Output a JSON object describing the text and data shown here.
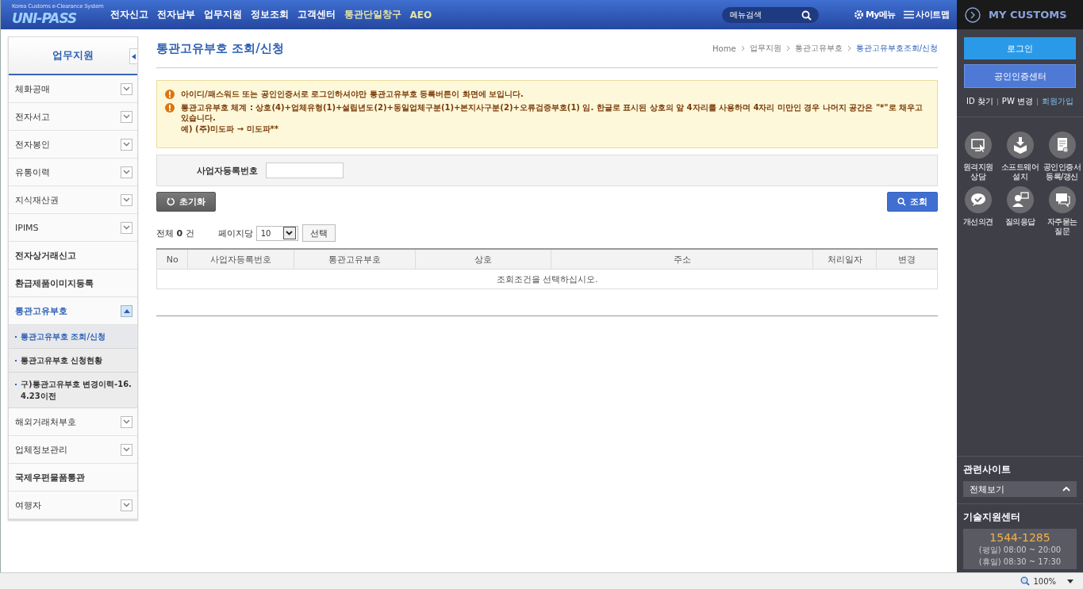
{
  "header": {
    "logo": "UNI-PASS",
    "logo_subtitle": "Korea Customs e-Clearance System",
    "nav": [
      {
        "label": "전자신고",
        "color": "#ffffff"
      },
      {
        "label": "전자납부",
        "color": "#ffffff"
      },
      {
        "label": "업무지원",
        "color": "#ffffff"
      },
      {
        "label": "정보조회",
        "color": "#ffffff"
      },
      {
        "label": "고객센터",
        "color": "#ffffff"
      },
      {
        "label": "통관단일창구",
        "color": "#e3e4a6"
      },
      {
        "label": "AEO",
        "color": "#e3e4a6"
      }
    ],
    "search": {
      "placeholder": "메뉴검색"
    },
    "my_menu": "My메뉴",
    "sitemap": "사이트맵"
  },
  "sidebar": {
    "title": "업무지원",
    "items": [
      {
        "label": "체화공매",
        "kind": "collapsible",
        "expanded": false
      },
      {
        "label": "전자서고",
        "kind": "collapsible",
        "expanded": false
      },
      {
        "label": "전자봉인",
        "kind": "collapsible",
        "expanded": false
      },
      {
        "label": "유통이력",
        "kind": "collapsible",
        "expanded": false
      },
      {
        "label": "지식재산권",
        "kind": "collapsible",
        "expanded": false
      },
      {
        "label": "IPIMS",
        "kind": "collapsible",
        "expanded": false
      },
      {
        "label": "전자상거래신고",
        "kind": "link"
      },
      {
        "label": "환급제품이미지등록",
        "kind": "link"
      },
      {
        "label": "통관고유부호",
        "kind": "collapsible",
        "expanded": true,
        "children": [
          {
            "label": "통관고유부호 조회/신청",
            "selected": true
          },
          {
            "label": "통관고유부호 신청현황",
            "selected": false
          },
          {
            "label": "구)통관고유부호 변경이력-16.4.23이전",
            "selected": false
          }
        ]
      },
      {
        "label": "해외거래처부호",
        "kind": "collapsible",
        "expanded": false
      },
      {
        "label": "업체정보관리",
        "kind": "collapsible",
        "expanded": false
      },
      {
        "label": "국제우편물품통관",
        "kind": "link"
      },
      {
        "label": "여행자",
        "kind": "collapsible",
        "expanded": false
      }
    ]
  },
  "main": {
    "title": "통관고유부호 조회/신청",
    "breadcrumb": [
      "Home",
      "업무지원",
      "통관고유부호",
      "통관고유부호조회/신청"
    ],
    "notices": [
      {
        "text": "아이디/패스워드 또는 공인인증서로 로그인하셔야만 통관고유부호 등록버튼이 화면에 보입니다."
      },
      {
        "text": "통관고유부호 체계 : 상호(4)+업체유형(1)+설립년도(2)+동일업체구분(1)+본지사구분(2)+오류검증부호(1) 임. 한글로 표시된 상호의 앞 4자리를 사용하며 4자리 미만인 경우 나머지 공간은 \"*\"로 채우고 있습니다.",
        "example": "예) (주)미도파 → 미도파**"
      }
    ],
    "search_label": "사업자등록번호",
    "reset_button": "초기화",
    "search_button": "조회",
    "total_label": "전체",
    "total_count": "0",
    "total_unit": "건",
    "per_page_label": "페이지당",
    "per_page": "10",
    "select_button": "선택",
    "table": {
      "columns": [
        "No",
        "사업자등록번호",
        "통관고유부호",
        "상호",
        "주소",
        "처리일자",
        "변경"
      ],
      "empty_message": "조회조건을 선택하십시오."
    }
  },
  "right_panel": {
    "title": "MY CUSTOMS",
    "login_button": "로그인",
    "cert_button": "공인인증센터",
    "links": [
      {
        "label": "ID 찾기",
        "kind": "plain"
      },
      {
        "label": "PW 변경",
        "kind": "plain"
      },
      {
        "label": "회원가입",
        "kind": "accent"
      }
    ],
    "services": [
      {
        "label": "원격지원 상담",
        "kind": "remote"
      },
      {
        "label": "소프트웨어 설치",
        "kind": "install"
      },
      {
        "label": "공인인증서 등록/갱신",
        "kind": "cert"
      },
      {
        "label": "개선의견",
        "kind": "chat"
      },
      {
        "label": "질의응답",
        "kind": "qa"
      },
      {
        "label": "자주묻는 질문",
        "kind": "faq"
      }
    ],
    "related_title": "관련사이트",
    "related_select": "전체보기",
    "support_title": "기술지원센터",
    "support_phone": "1544-1285",
    "support_hours": [
      "(평일) 08:00 ~ 20:00",
      "(휴일) 08:30 ~ 17:30"
    ]
  },
  "status_bar": {
    "zoom": "100%"
  }
}
